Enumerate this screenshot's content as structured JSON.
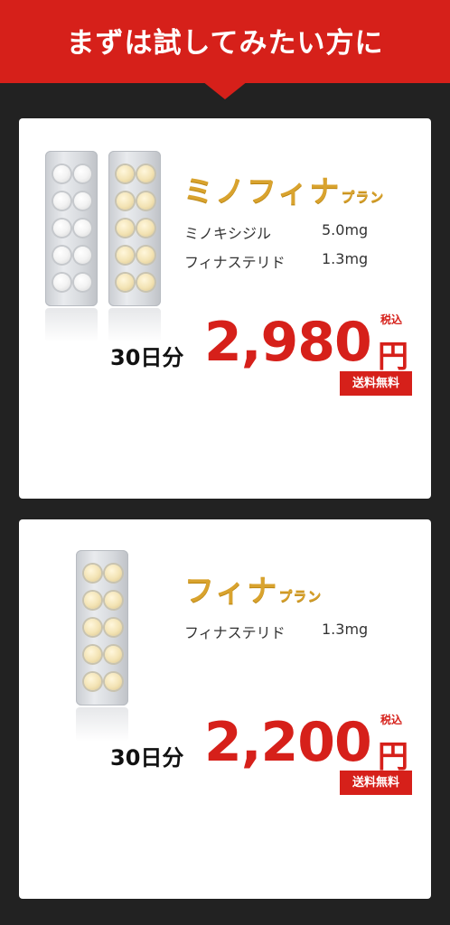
{
  "header": {
    "title": "まずは試してみたい方に"
  },
  "plans": [
    {
      "name": "ミノフィナ",
      "suffix": "プラン",
      "ingredients": [
        {
          "name": "ミノキシジル",
          "dose": "5.0mg"
        },
        {
          "name": "フィナステリド",
          "dose": "1.3mg"
        }
      ],
      "days": "30日分",
      "price": "2,980",
      "currency": "円",
      "tax_note": "税込",
      "shipping": "送料無料"
    },
    {
      "name": "フィナ",
      "suffix": "プラン",
      "ingredients": [
        {
          "name": "フィナステリド",
          "dose": "1.3mg"
        }
      ],
      "days": "30日分",
      "price": "2,200",
      "currency": "円",
      "tax_note": "税込",
      "shipping": "送料無料"
    }
  ],
  "colors": {
    "brand_red": "#d6201a",
    "gold": "#d9a32e",
    "background": "#222222"
  }
}
